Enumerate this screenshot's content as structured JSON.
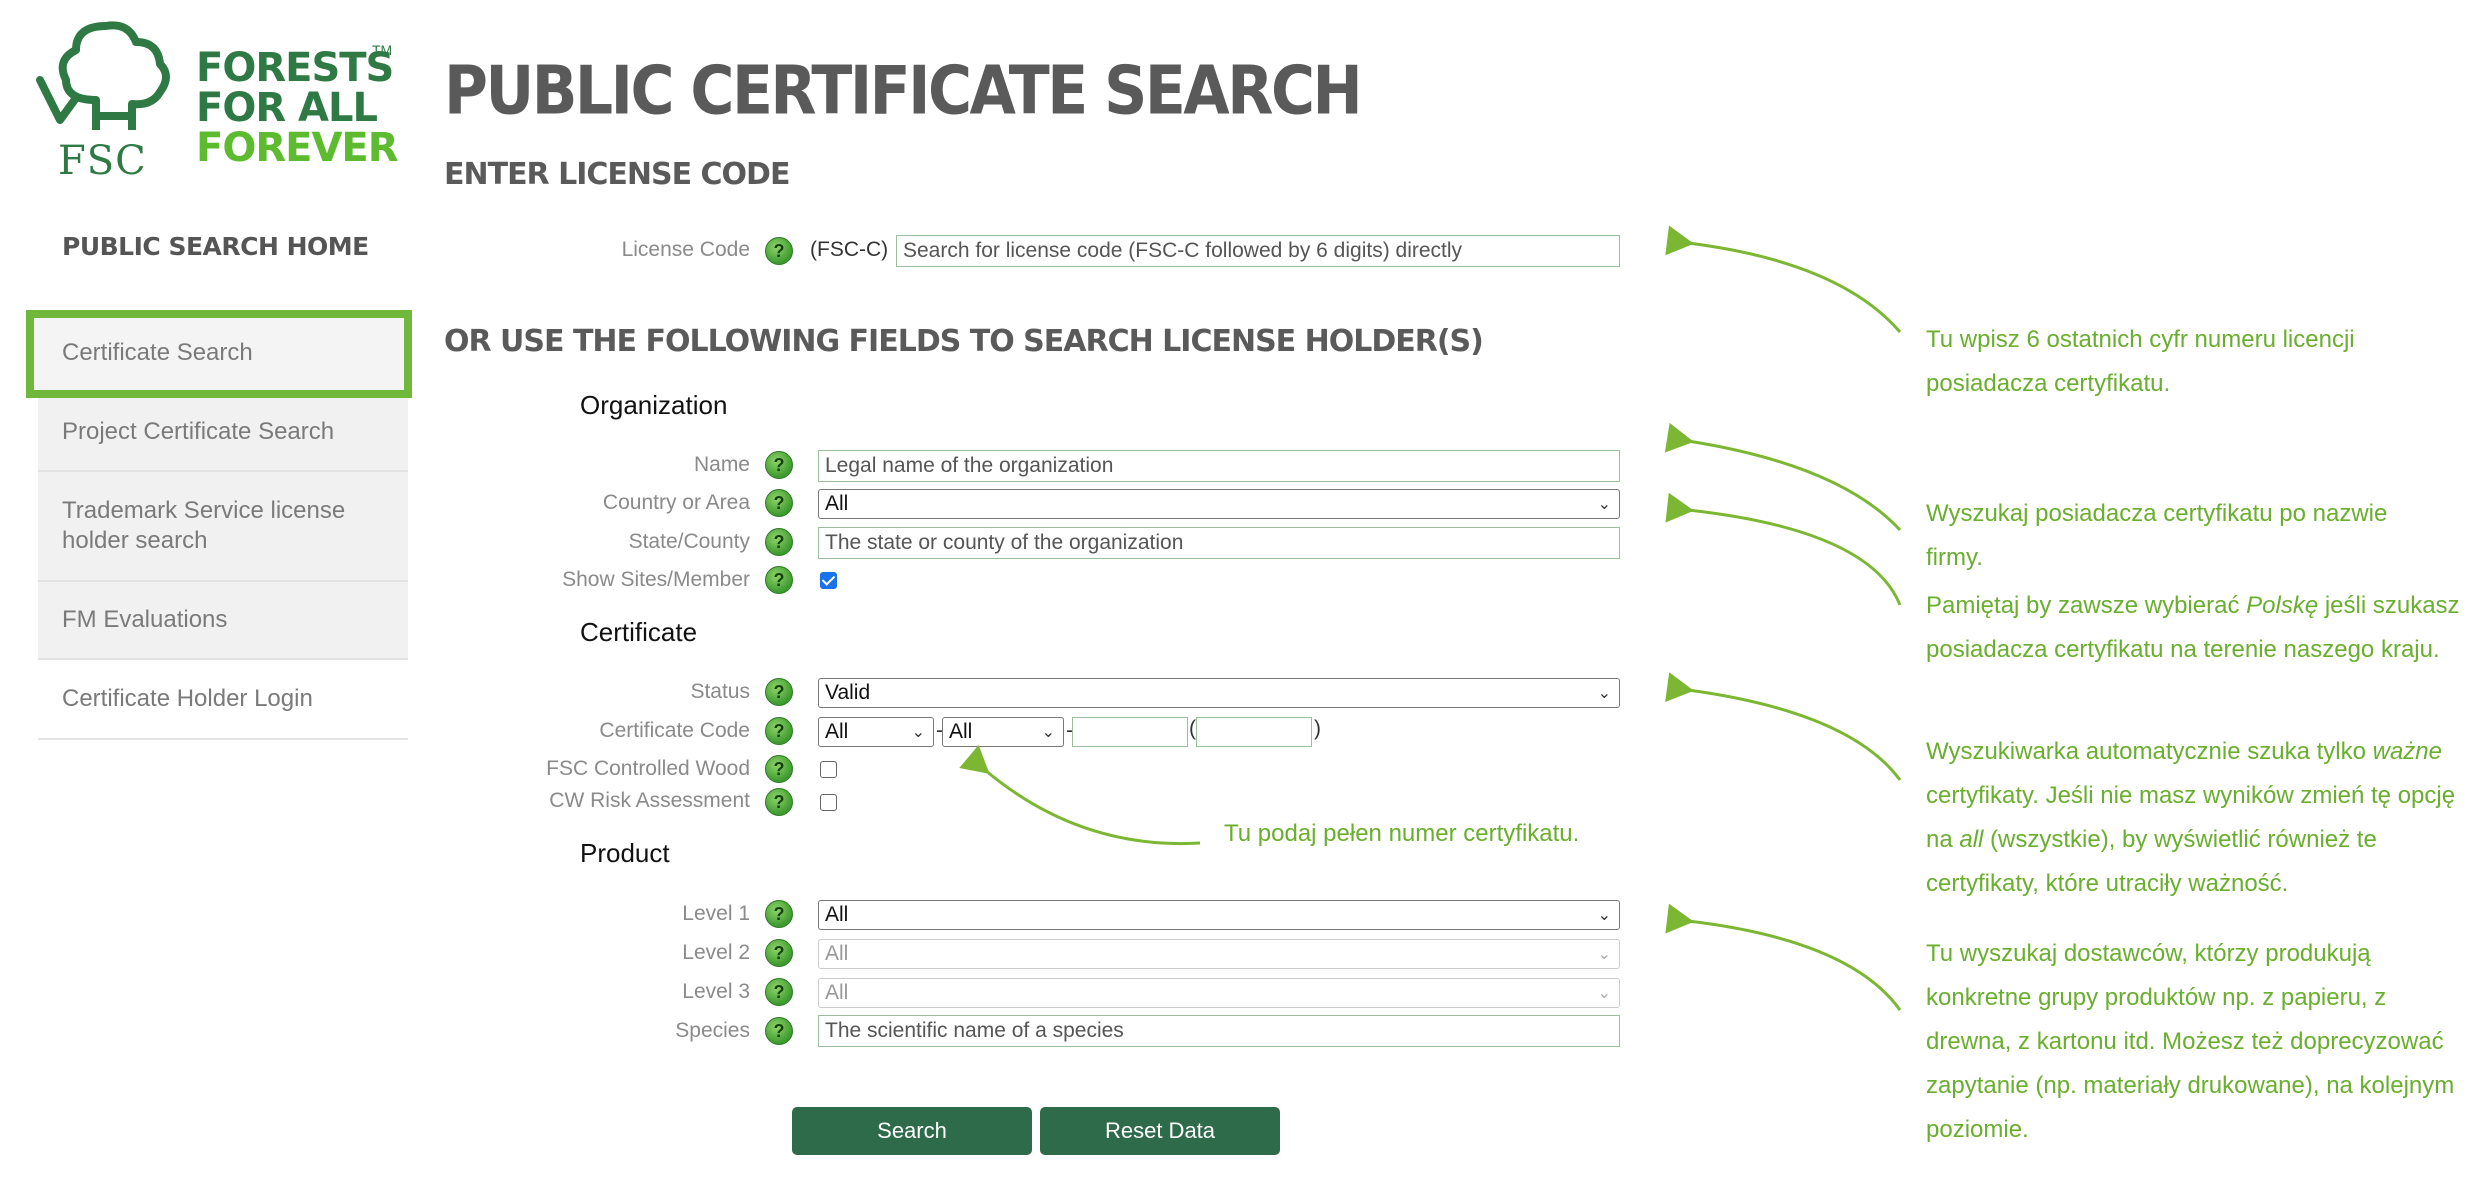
{
  "logo": {
    "line1": "FORESTS",
    "line2": "FOR ALL",
    "line3": "FOREVER",
    "tm": "TM",
    "fsc": "FSC"
  },
  "sidebar": {
    "home": "PUBLIC SEARCH HOME",
    "items": [
      {
        "label": "Certificate Search",
        "active": true
      },
      {
        "label": "Project Certificate Search"
      },
      {
        "label": "Trademark Service license holder search"
      },
      {
        "label": "FM Evaluations"
      },
      {
        "label": "Certificate Holder Login"
      }
    ]
  },
  "page": {
    "title": "PUBLIC CERTIFICATE SEARCH",
    "license_heading": "ENTER LICENSE CODE",
    "fields_heading": "OR USE THE FOLLOWING FIELDS TO SEARCH LICENSE HOLDER(S)"
  },
  "license": {
    "label": "License Code",
    "prefix": "(FSC-C)",
    "placeholder": "Search for license code (FSC-C followed by 6 digits) directly"
  },
  "organization": {
    "heading": "Organization",
    "name_label": "Name",
    "name_placeholder": "Legal name of the organization",
    "country_label": "Country or Area",
    "country_value": "All",
    "state_label": "State/County",
    "state_placeholder": "The state or county of the organization",
    "sites_label": "Show Sites/Member",
    "sites_checked": true
  },
  "certificate": {
    "heading": "Certificate",
    "status_label": "Status",
    "status_value": "Valid",
    "code_label": "Certificate Code",
    "code_part1": "All",
    "code_part2": "All",
    "code_sep": "-",
    "code_paren_open": "(",
    "code_paren_close": ")",
    "cw_label": "FSC Controlled Wood",
    "cwra_label": "CW Risk Assessment"
  },
  "product": {
    "heading": "Product",
    "level1_label": "Level 1",
    "level1_value": "All",
    "level2_label": "Level 2",
    "level2_value": "All",
    "level3_label": "Level 3",
    "level3_value": "All",
    "species_label": "Species",
    "species_placeholder": "The scientific name of a species"
  },
  "buttons": {
    "search": "Search",
    "reset": "Reset Data"
  },
  "help_glyph": "?",
  "chevron_glyph": "⌄",
  "annotations": {
    "license_note": [
      "Tu wpisz 6 ostatnich cyfr numeru licencji",
      "posiadacza certyfikatu."
    ],
    "name_note": [
      "Wyszukaj posiadacza certyfikatu po nazwie",
      "firmy."
    ],
    "country_note_before": "Pamiętaj by zawsze wybierać ",
    "country_note_em": "Polskę",
    "country_note_after": " jeśli szukasz",
    "country_note_line2": "posiadacza certyfikatu na terenie naszego kraju.",
    "status_note_before": "Wyszukiwarka automatycznie szuka tylko ",
    "status_note_em": "ważne",
    "status_note_line2": "certyfikaty. Jeśli nie masz wyników zmień tę opcję",
    "status_note_line3_before": "na ",
    "status_note_line3_em": "all",
    "status_note_line3_after": " (wszystkie), by wyświetlić również te",
    "status_note_line4": "certyfikaty, które utraciły ważność.",
    "code_note": "Tu podaj pełen numer certyfikatu.",
    "product_note": [
      "Tu wyszukaj dostawców, którzy produkują",
      "konkretne grupy produktów np. z papieru, z",
      "drewna, z kartonu itd. Możesz też doprecyzować",
      "zapytanie (np. materiały drukowane), na kolejnym",
      "poziomie."
    ]
  },
  "colors": {
    "accent_green": "#6fb83c",
    "button_green": "#2e6b4a",
    "logo_dark": "#2f7a44",
    "logo_light": "#5cbb2e"
  }
}
